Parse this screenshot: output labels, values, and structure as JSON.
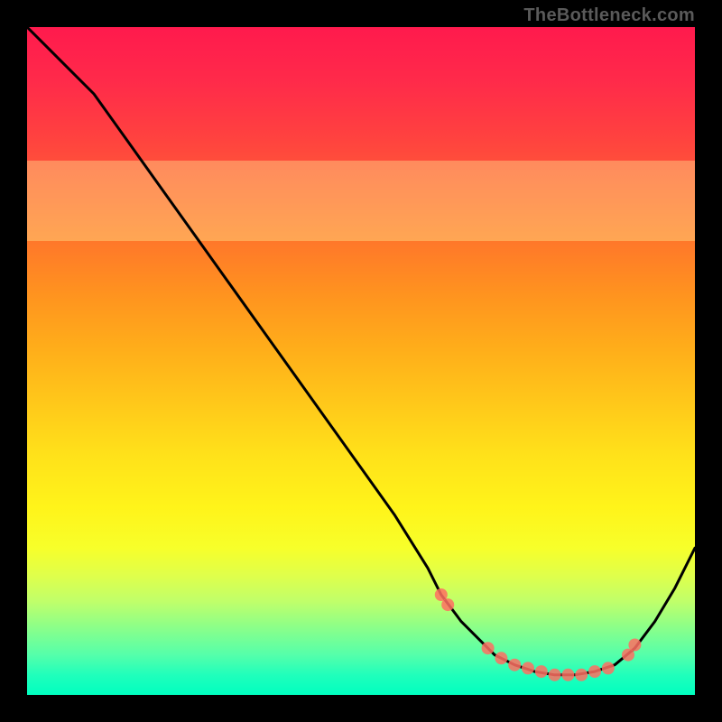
{
  "attribution": "TheBottleneck.com",
  "chart_data": {
    "type": "line",
    "title": "",
    "xlabel": "",
    "ylabel": "",
    "xlim": [
      0,
      100
    ],
    "ylim": [
      0,
      100
    ],
    "series": [
      {
        "name": "curve",
        "x": [
          0,
          3,
          6,
          10,
          15,
          20,
          25,
          30,
          35,
          40,
          45,
          50,
          55,
          60,
          62,
          65,
          68,
          70,
          73,
          76,
          79,
          82,
          85,
          88,
          91,
          94,
          97,
          100
        ],
        "y": [
          100,
          97,
          94,
          90,
          83,
          76,
          69,
          62,
          55,
          48,
          41,
          34,
          27,
          19,
          15,
          11,
          8,
          6,
          4.5,
          3.5,
          3,
          3,
          3.5,
          4.5,
          7,
          11,
          16,
          22
        ]
      }
    ],
    "markers": {
      "name": "points",
      "x": [
        62,
        63,
        69,
        71,
        73,
        75,
        77,
        79,
        81,
        83,
        85,
        87,
        90,
        91
      ],
      "y": [
        15,
        13.5,
        7,
        5.5,
        4.5,
        4,
        3.5,
        3,
        3,
        3,
        3.5,
        4,
        6,
        7.5
      ],
      "color": "#ff6f61",
      "radius": 7
    },
    "highlight_band": {
      "y_from": 68,
      "y_to": 80
    }
  },
  "colors": {
    "curve": "#000000",
    "marker_fill": "#ff6f61",
    "marker_stroke": "#ff6f61",
    "background_black": "#000000"
  }
}
